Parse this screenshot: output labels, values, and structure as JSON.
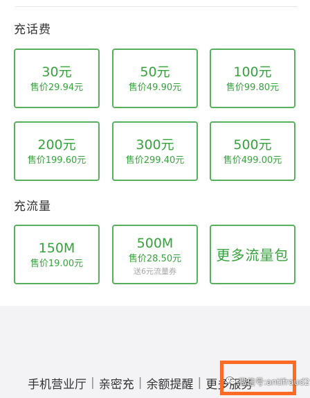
{
  "recharge": {
    "title": "充话费",
    "items": [
      {
        "amount": "30元",
        "price": "售价29.94元"
      },
      {
        "amount": "50元",
        "price": "售价49.90元"
      },
      {
        "amount": "100元",
        "price": "售价99.80元"
      },
      {
        "amount": "200元",
        "price": "售价199.60元"
      },
      {
        "amount": "300元",
        "price": "售价299.40元"
      },
      {
        "amount": "500元",
        "price": "售价499.00元"
      }
    ]
  },
  "data": {
    "title": "充流量",
    "items": [
      {
        "amount": "150M",
        "price": "售价19.00元"
      },
      {
        "amount": "500M",
        "price": "售价28.50元",
        "bonus": "送6元流量券"
      }
    ],
    "more": "更多流量包"
  },
  "bottom": {
    "links": [
      "手机营业厅",
      "亲密充",
      "余额提醒",
      "更多服务"
    ],
    "separator": "|"
  },
  "watermark": {
    "icon": "wechat-icon",
    "text": "微信号:antifraud2"
  },
  "colors": {
    "accent": "#35a33b",
    "border": "#57b05c",
    "highlight": "#ff6a24"
  }
}
